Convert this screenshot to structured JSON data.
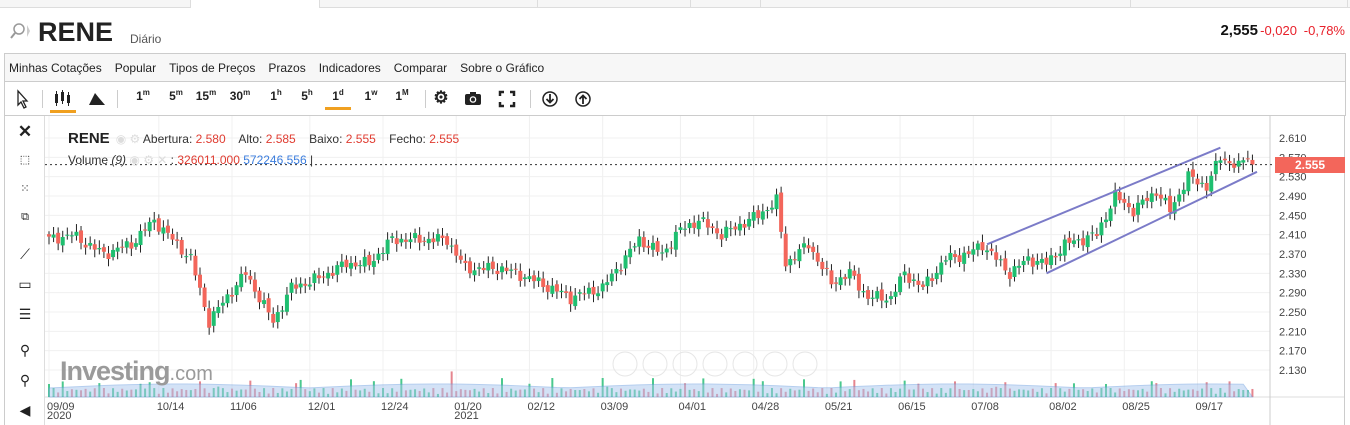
{
  "header": {
    "symbol": "RENE",
    "period": "Diário",
    "price": "2,555",
    "change": "-0,020",
    "change_pct": "-0,78%"
  },
  "menu": [
    "Minhas Cotações",
    "Popular",
    "Tipos de Preços",
    "Prazos",
    "Indicadores",
    "Comparar",
    "Sobre o Gráfico"
  ],
  "timeframes": [
    {
      "n": "1",
      "u": "m"
    },
    {
      "n": "5",
      "u": "m"
    },
    {
      "n": "15",
      "u": "m"
    },
    {
      "n": "30",
      "u": "m"
    },
    {
      "n": "1",
      "u": "h"
    },
    {
      "n": "5",
      "u": "h"
    },
    {
      "n": "1",
      "u": "d"
    },
    {
      "n": "1",
      "u": "w"
    },
    {
      "n": "1",
      "u": "M"
    }
  ],
  "selected_timeframe": "1d",
  "legend": {
    "symbol": "RENE",
    "open_label": "Abertura:",
    "open": "2.580",
    "high_label": "Alto:",
    "high": "2.585",
    "low_label": "Baixo:",
    "low": "2.555",
    "close_label": "Fecho:",
    "close": "2.555",
    "volume_label": "Volume",
    "volume_period": "(9)",
    "volume_value": "326011.000",
    "volume_ma": "572246.556"
  },
  "price_tag": "2.555",
  "logo": {
    "main": "Investing",
    "suffix": ".com"
  },
  "colors": {
    "up": "#1fbf70",
    "down": "#f3665b",
    "channel": "#7b7bc8",
    "accent": "#f0a020"
  },
  "chart_data": {
    "type": "candlestick",
    "ylim": [
      2.11,
      2.63
    ],
    "y_ticks": [
      "2.610",
      "2.570",
      "2.530",
      "2.490",
      "2.450",
      "2.410",
      "2.370",
      "2.330",
      "2.290",
      "2.250",
      "2.210",
      "2.170",
      "2.130"
    ],
    "x_ticks": [
      {
        "label": "09/09",
        "sub": "2020",
        "i": 0
      },
      {
        "label": "10/14",
        "i": 24
      },
      {
        "label": "11/06",
        "i": 40
      },
      {
        "label": "12/01",
        "i": 57
      },
      {
        "label": "12/24",
        "i": 73
      },
      {
        "label": "01/20",
        "sub": "2021",
        "i": 89
      },
      {
        "label": "02/12",
        "i": 105
      },
      {
        "label": "03/09",
        "i": 121
      },
      {
        "label": "04/01",
        "i": 138
      },
      {
        "label": "04/28",
        "i": 154
      },
      {
        "label": "05/21",
        "i": 170
      },
      {
        "label": "06/15",
        "i": 186
      },
      {
        "label": "07/08",
        "i": 202
      },
      {
        "label": "08/02",
        "i": 219
      },
      {
        "label": "08/25",
        "i": 235
      },
      {
        "label": "09/17",
        "i": 251
      }
    ],
    "count": 264,
    "close_keypoints": [
      [
        0,
        2.4
      ],
      [
        5,
        2.41
      ],
      [
        12,
        2.37
      ],
      [
        18,
        2.39
      ],
      [
        23,
        2.44
      ],
      [
        28,
        2.39
      ],
      [
        31,
        2.36
      ],
      [
        35,
        2.23
      ],
      [
        38,
        2.27
      ],
      [
        43,
        2.33
      ],
      [
        49,
        2.23
      ],
      [
        53,
        2.3
      ],
      [
        59,
        2.32
      ],
      [
        65,
        2.35
      ],
      [
        70,
        2.35
      ],
      [
        75,
        2.4
      ],
      [
        81,
        2.4
      ],
      [
        87,
        2.4
      ],
      [
        91,
        2.34
      ],
      [
        99,
        2.34
      ],
      [
        105,
        2.32
      ],
      [
        114,
        2.28
      ],
      [
        121,
        2.3
      ],
      [
        125,
        2.35
      ],
      [
        129,
        2.4
      ],
      [
        134,
        2.37
      ],
      [
        138,
        2.42
      ],
      [
        142,
        2.44
      ],
      [
        147,
        2.41
      ],
      [
        151,
        2.43
      ],
      [
        155,
        2.45
      ],
      [
        159,
        2.48
      ],
      [
        161,
        2.35
      ],
      [
        166,
        2.39
      ],
      [
        171,
        2.31
      ],
      [
        175,
        2.33
      ],
      [
        179,
        2.28
      ],
      [
        184,
        2.28
      ],
      [
        187,
        2.33
      ],
      [
        191,
        2.3
      ],
      [
        196,
        2.36
      ],
      [
        201,
        2.37
      ],
      [
        204,
        2.39
      ],
      [
        210,
        2.33
      ],
      [
        214,
        2.36
      ],
      [
        218,
        2.35
      ],
      [
        222,
        2.39
      ],
      [
        229,
        2.41
      ],
      [
        233,
        2.49
      ],
      [
        237,
        2.46
      ],
      [
        242,
        2.5
      ],
      [
        245,
        2.46
      ],
      [
        249,
        2.53
      ],
      [
        253,
        2.51
      ],
      [
        256,
        2.57
      ],
      [
        260,
        2.55
      ],
      [
        262,
        2.575
      ],
      [
        263,
        2.555
      ]
    ],
    "channel": {
      "upper": [
        [
          205,
          2.39
        ],
        [
          256,
          2.59
        ]
      ],
      "lower": [
        [
          218,
          2.33
        ],
        [
          264,
          2.54
        ]
      ]
    },
    "last_price": 2.555
  }
}
